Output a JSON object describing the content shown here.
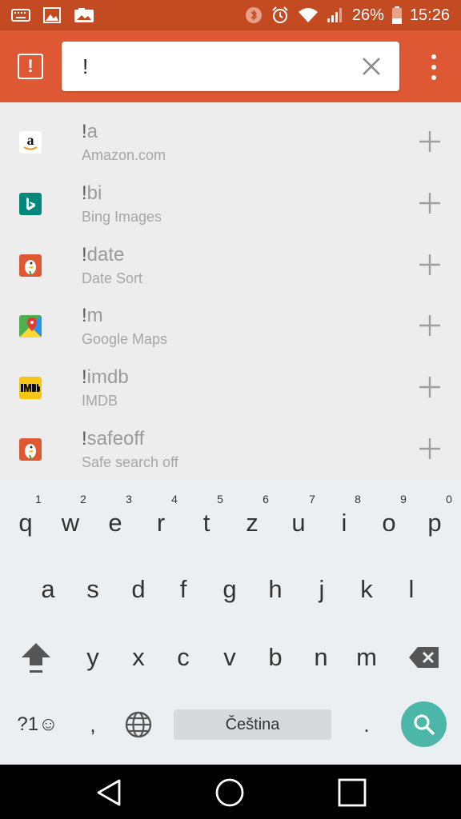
{
  "status_bar": {
    "battery": "26%",
    "time": "15:26",
    "left_icons": [
      "keyboard-icon",
      "image-icon",
      "photo-icon"
    ],
    "right_icons": [
      "bluetooth-icon",
      "alarm-icon",
      "wifi-icon",
      "signal-icon",
      "battery-icon"
    ]
  },
  "app_bar": {
    "logo_glyph": "!",
    "search_value": "!",
    "search_placeholder": "",
    "clear_icon": "close-icon",
    "menu_icon": "overflow-menu-icon",
    "colors": {
      "appbar": "#de5833",
      "statusbar": "#c44a22"
    }
  },
  "results": [
    {
      "bang_typed": "!",
      "bang_rest": "a",
      "description": "Amazon.com",
      "icon": "amazon-icon"
    },
    {
      "bang_typed": "!",
      "bang_rest": "bi",
      "description": "Bing Images",
      "icon": "bing-icon"
    },
    {
      "bang_typed": "!",
      "bang_rest": "date",
      "description": "Date Sort",
      "icon": "duckduckgo-icon"
    },
    {
      "bang_typed": "!",
      "bang_rest": "m",
      "description": "Google Maps",
      "icon": "google-maps-icon"
    },
    {
      "bang_typed": "!",
      "bang_rest": "imdb",
      "description": "IMDB",
      "icon": "imdb-icon"
    },
    {
      "bang_typed": "!",
      "bang_rest": "safeoff",
      "description": "Safe search off",
      "icon": "duckduckgo-icon"
    }
  ],
  "keyboard": {
    "row1": [
      "q",
      "w",
      "e",
      "r",
      "t",
      "z",
      "u",
      "i",
      "o",
      "p"
    ],
    "row1_hints": [
      "1",
      "2",
      "3",
      "4",
      "5",
      "6",
      "7",
      "8",
      "9",
      "0"
    ],
    "row2": [
      "a",
      "s",
      "d",
      "f",
      "g",
      "h",
      "j",
      "k",
      "l"
    ],
    "row3": [
      "y",
      "x",
      "c",
      "v",
      "b",
      "n",
      "m"
    ],
    "symbols_label": "?1☺",
    "comma": ",",
    "period": ".",
    "space_label": "Čeština",
    "search_color": "#4cb6a8"
  },
  "nav_bar": {
    "back_icon": "back-icon",
    "home_icon": "home-icon",
    "recents_icon": "recents-icon"
  }
}
